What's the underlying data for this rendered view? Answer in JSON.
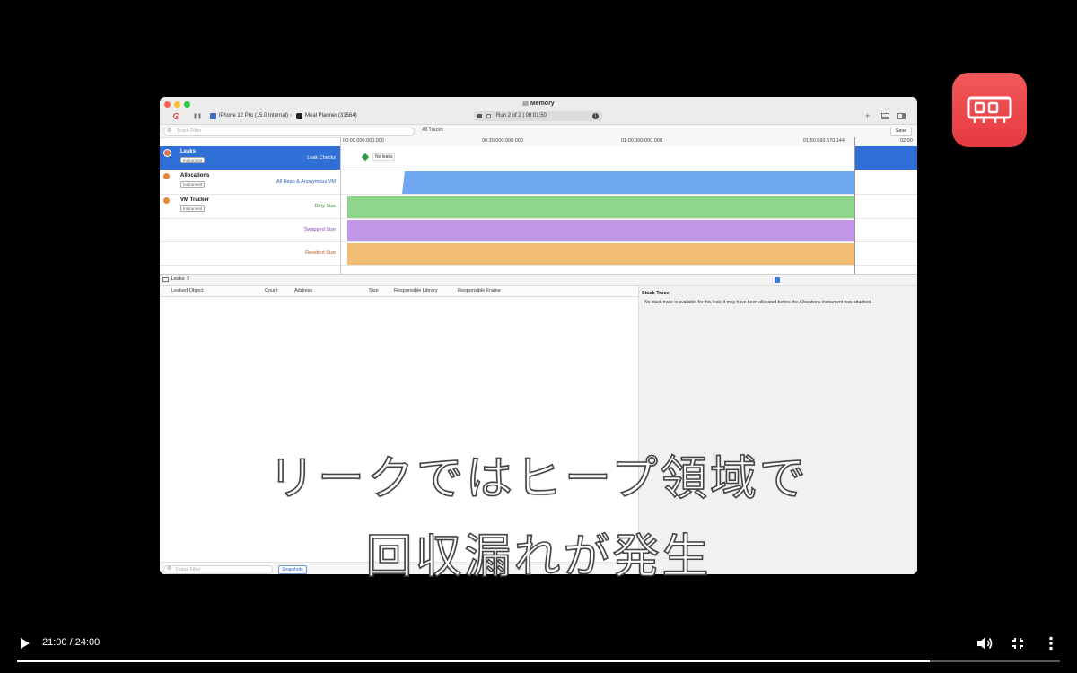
{
  "window": {
    "title": "Memory",
    "device": "iPhone 12 Pro (15.0 Internal)",
    "target": "Meal Planner",
    "target_pid": "(31564)",
    "run_label": "Run 2 of 2",
    "run_time": "00:01:50",
    "track_filter_placeholder": "Track Filter",
    "all_tracks": "All Tracks",
    "save_label": "Save"
  },
  "ruler": {
    "ticks": [
      "00:00.000.000.000",
      "00:30.000.000.000",
      "01:00.000.000.000",
      "01:50.660.570.144",
      "02:00"
    ]
  },
  "instruments": [
    {
      "name": "Leaks",
      "badge": "Instrument",
      "track": "Leak Checks",
      "color": "#d9775b"
    },
    {
      "name": "Allocations",
      "badge": "Instrument",
      "track": "All Heap & Anonymous VM",
      "color": "#e3873a"
    },
    {
      "name": "VM Tracker",
      "badge": "Instrument",
      "track": "Dirty Size",
      "color": "#e38a3a"
    }
  ],
  "vm_tracks": [
    "Swapped Size",
    "Resident Size"
  ],
  "leak_status": "No leaks",
  "track_colors": {
    "allocations": "#6fa8f0",
    "dirty": "#8fd68a",
    "swapped": "#c196e6",
    "resident": "#f0bd72"
  },
  "detail": {
    "selector": "Leaks",
    "columns": [
      "Leaked Object",
      "Count",
      "Address",
      "Size",
      "Responsible Library",
      "Responsible Frame"
    ],
    "stack_trace_title": "Stack Trace",
    "stack_trace_message": "No stack trace is available for this leak; it may have been allocated before the Allocations instrument was attached.",
    "detail_filter_placeholder": "Detail Filter",
    "snapshots_label": "Snapshots"
  },
  "subtitles": [
    "リークではヒープ領域で",
    "回収漏れが発生"
  ],
  "player": {
    "time": "21:00 / 24:00",
    "progress": 0.875
  }
}
